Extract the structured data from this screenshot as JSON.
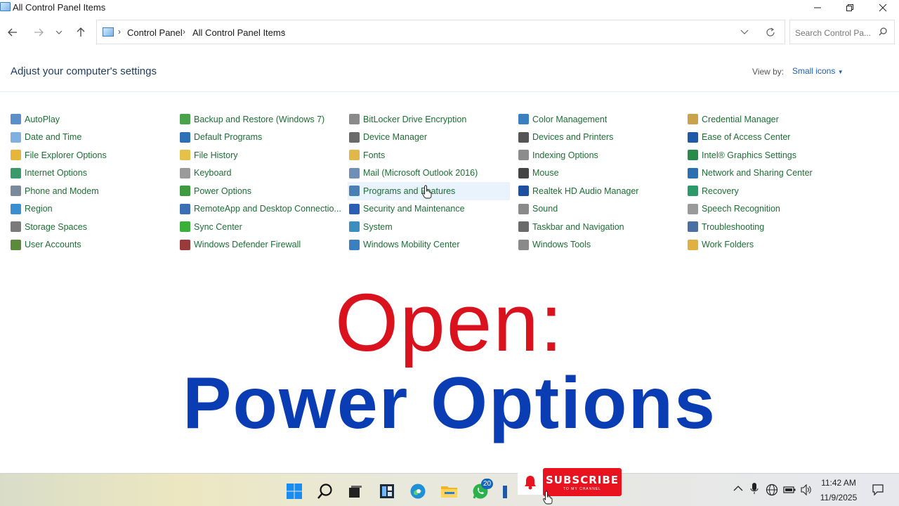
{
  "window": {
    "title": "All Control Panel Items"
  },
  "breadcrumb": {
    "items": [
      "Control Panel",
      "All Control Panel Items"
    ]
  },
  "search": {
    "placeholder": "Search Control Pa..."
  },
  "header": {
    "title": "Adjust your computer's settings",
    "view_by_label": "View by:",
    "view_by_value": "Small icons"
  },
  "items": [
    {
      "label": "AutoPlay",
      "icon": "autoplay-icon",
      "color": "#5b8fc9"
    },
    {
      "label": "Backup and Restore (Windows 7)",
      "icon": "backup-icon",
      "color": "#4aa34a"
    },
    {
      "label": "BitLocker Drive Encryption",
      "icon": "bitlocker-icon",
      "color": "#8a8a8a"
    },
    {
      "label": "Color Management",
      "icon": "color-management-icon",
      "color": "#3a7fbf"
    },
    {
      "label": "Credential Manager",
      "icon": "credential-manager-icon",
      "color": "#c9a34a"
    },
    {
      "label": "Date and Time",
      "icon": "date-time-icon",
      "color": "#7fb0e0"
    },
    {
      "label": "Default Programs",
      "icon": "default-programs-icon",
      "color": "#2f6fb5"
    },
    {
      "label": "Device Manager",
      "icon": "device-manager-icon",
      "color": "#6a6a6a"
    },
    {
      "label": "Devices and Printers",
      "icon": "devices-printers-icon",
      "color": "#555555"
    },
    {
      "label": "Ease of Access Center",
      "icon": "ease-of-access-icon",
      "color": "#1e5aa8"
    },
    {
      "label": "File Explorer Options",
      "icon": "file-explorer-options-icon",
      "color": "#e5b63a"
    },
    {
      "label": "File History",
      "icon": "file-history-icon",
      "color": "#e5c14a"
    },
    {
      "label": "Fonts",
      "icon": "fonts-icon",
      "color": "#e0b84a"
    },
    {
      "label": "Indexing Options",
      "icon": "indexing-options-icon",
      "color": "#8c8c8c"
    },
    {
      "label": "Intel® Graphics Settings",
      "icon": "intel-graphics-icon",
      "color": "#2a8a4a"
    },
    {
      "label": "Internet Options",
      "icon": "internet-options-icon",
      "color": "#3a9a6a"
    },
    {
      "label": "Keyboard",
      "icon": "keyboard-icon",
      "color": "#9a9a9a"
    },
    {
      "label": "Mail (Microsoft Outlook 2016)",
      "icon": "mail-icon",
      "color": "#6d8fb8"
    },
    {
      "label": "Mouse",
      "icon": "mouse-icon",
      "color": "#444444"
    },
    {
      "label": "Network and Sharing Center",
      "icon": "network-sharing-icon",
      "color": "#2a6fb0"
    },
    {
      "label": "Phone and Modem",
      "icon": "phone-modem-icon",
      "color": "#7a8a9a"
    },
    {
      "label": "Power Options",
      "icon": "power-options-icon",
      "color": "#3f9b3f"
    },
    {
      "label": "Programs and Features",
      "icon": "programs-features-icon",
      "color": "#4a7fb5"
    },
    {
      "label": "Realtek HD Audio Manager",
      "icon": "realtek-audio-icon",
      "color": "#1e4fa0"
    },
    {
      "label": "Recovery",
      "icon": "recovery-icon",
      "color": "#2a9a6a"
    },
    {
      "label": "Region",
      "icon": "region-icon",
      "color": "#3a8fd0"
    },
    {
      "label": "RemoteApp and Desktop Connectio...",
      "icon": "remoteapp-icon",
      "color": "#3a6fb5"
    },
    {
      "label": "Security and Maintenance",
      "icon": "security-maintenance-icon",
      "color": "#2a5fb5"
    },
    {
      "label": "Sound",
      "icon": "sound-icon",
      "color": "#8a8a8a"
    },
    {
      "label": "Speech Recognition",
      "icon": "speech-recognition-icon",
      "color": "#9a9a9a"
    },
    {
      "label": "Storage Spaces",
      "icon": "storage-spaces-icon",
      "color": "#7a7a7a"
    },
    {
      "label": "Sync Center",
      "icon": "sync-center-icon",
      "color": "#3ab03a"
    },
    {
      "label": "System",
      "icon": "system-icon",
      "color": "#3a8fc0"
    },
    {
      "label": "Taskbar and Navigation",
      "icon": "taskbar-navigation-icon",
      "color": "#6a6a6a"
    },
    {
      "label": "Troubleshooting",
      "icon": "troubleshooting-icon",
      "color": "#4a6fa5"
    },
    {
      "label": "User Accounts",
      "icon": "user-accounts-icon",
      "color": "#5a8a3a"
    },
    {
      "label": "Windows Defender Firewall",
      "icon": "firewall-icon",
      "color": "#9a3a3a"
    },
    {
      "label": "Windows Mobility Center",
      "icon": "mobility-center-icon",
      "color": "#3a7fbf"
    },
    {
      "label": "Windows Tools",
      "icon": "windows-tools-icon",
      "color": "#8a8a8a"
    },
    {
      "label": "Work Folders",
      "icon": "work-folders-icon",
      "color": "#e0b040"
    }
  ],
  "overlay": {
    "line1": "Open:",
    "line2": "Power Options"
  },
  "subscribe": {
    "label": "SUBSCRIBE",
    "sub": "TO MY CHANNEL"
  },
  "taskbar": {
    "whatsapp_badge": "20",
    "time": "11:42 AM",
    "date": "11/9/2025"
  }
}
